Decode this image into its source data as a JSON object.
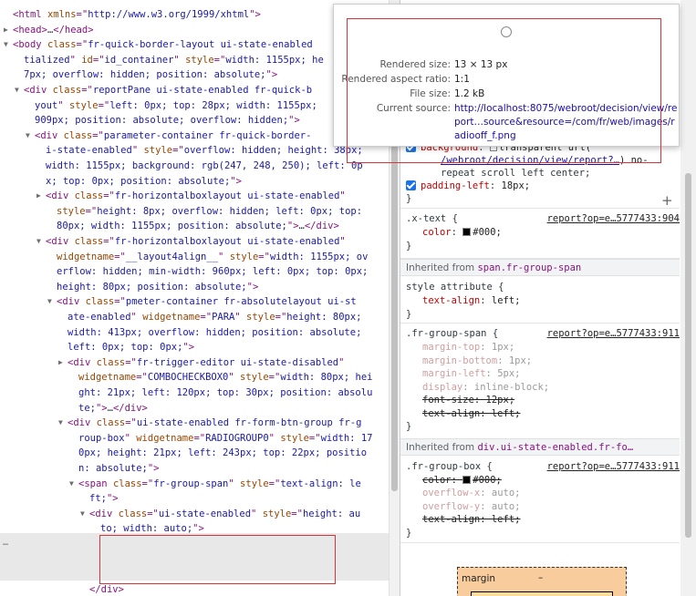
{
  "elements": {
    "lines": [
      {
        "indent": 1,
        "tri": "",
        "parts": [
          [
            "tag",
            "<html "
          ],
          [
            "attr",
            "xmlns"
          ],
          [
            "tag",
            "=\""
          ],
          [
            "val",
            "http://www.w3.org/1999/xhtml"
          ],
          [
            "tag",
            "\">"
          ]
        ]
      },
      {
        "indent": 1,
        "tri": "▶",
        "parts": [
          [
            "tag",
            "<head>"
          ],
          [
            "txt",
            "…"
          ],
          [
            "tag",
            "</head>"
          ]
        ]
      },
      {
        "indent": 1,
        "tri": "▼",
        "parts": [
          [
            "tag",
            "<body "
          ],
          [
            "attr",
            "class"
          ],
          [
            "tag",
            "=\""
          ],
          [
            "val",
            "fr-quick-border-layout ui-state-enabled"
          ]
        ]
      },
      {
        "indent": 2,
        "tri": "",
        "parts": [
          [
            "val",
            "tialized"
          ],
          [
            "tag",
            "\" "
          ],
          [
            "attr",
            "id"
          ],
          [
            "tag",
            "=\""
          ],
          [
            "val",
            "id_container"
          ],
          [
            "tag",
            "\" "
          ],
          [
            "attr",
            "style"
          ],
          [
            "tag",
            "=\""
          ],
          [
            "val",
            "width: 1155px; he"
          ]
        ]
      },
      {
        "indent": 2,
        "tri": "",
        "parts": [
          [
            "val",
            "7px; overflow: hidden; position: absolute;"
          ],
          [
            "tag",
            "\">"
          ]
        ]
      },
      {
        "indent": 2,
        "tri": "▼",
        "parts": [
          [
            "tag",
            "<div "
          ],
          [
            "attr",
            "class"
          ],
          [
            "tag",
            "=\""
          ],
          [
            "val",
            "reportPane ui-state-enabled fr-quick-b"
          ]
        ]
      },
      {
        "indent": 3,
        "tri": "",
        "parts": [
          [
            "val",
            "yout"
          ],
          [
            "tag",
            "\" "
          ],
          [
            "attr",
            "style"
          ],
          [
            "tag",
            "=\""
          ],
          [
            "val",
            "left: 0px; top: 28px; width: 1155px;"
          ]
        ]
      },
      {
        "indent": 3,
        "tri": "",
        "parts": [
          [
            "val",
            "909px; position: absolute; overflow: hidden;"
          ],
          [
            "tag",
            "\">"
          ]
        ]
      },
      {
        "indent": 3,
        "tri": "▼",
        "parts": [
          [
            "tag",
            "<div "
          ],
          [
            "attr",
            "class"
          ],
          [
            "tag",
            "=\""
          ],
          [
            "val",
            "parameter-container fr-quick-border-"
          ]
        ]
      },
      {
        "indent": 4,
        "tri": "",
        "parts": [
          [
            "val",
            "i-state-enabled"
          ],
          [
            "tag",
            "\" "
          ],
          [
            "attr",
            "style"
          ],
          [
            "tag",
            "=\""
          ],
          [
            "val",
            "overflow: hidden; height: 38px;"
          ]
        ]
      },
      {
        "indent": 4,
        "tri": "",
        "parts": [
          [
            "val",
            "width: 1155px; background: rgb(247, 248, 250); left: 0p"
          ]
        ]
      },
      {
        "indent": 4,
        "tri": "",
        "parts": [
          [
            "val",
            "x; top: 0px; position: absolute;"
          ],
          [
            "tag",
            "\">"
          ]
        ]
      },
      {
        "indent": 4,
        "tri": "▶",
        "parts": [
          [
            "tag",
            "<div "
          ],
          [
            "attr",
            "class"
          ],
          [
            "tag",
            "=\""
          ],
          [
            "val",
            "fr-horizontalboxlayout ui-state-enabled"
          ],
          [
            "tag",
            "\""
          ]
        ]
      },
      {
        "indent": 5,
        "tri": "",
        "parts": [
          [
            "attr",
            "style"
          ],
          [
            "tag",
            "=\""
          ],
          [
            "val",
            "height: 8px; overflow: hidden; left: 0px; top:"
          ]
        ]
      },
      {
        "indent": 5,
        "tri": "",
        "parts": [
          [
            "val",
            "80px; width: 1155px; position: absolute;"
          ],
          [
            "tag",
            "\">"
          ],
          [
            "txt",
            "…"
          ],
          [
            "tag",
            "</div>"
          ]
        ]
      },
      {
        "indent": 4,
        "tri": "▼",
        "parts": [
          [
            "tag",
            "<div "
          ],
          [
            "attr",
            "class"
          ],
          [
            "tag",
            "=\""
          ],
          [
            "val",
            "fr-horizontalboxlayout ui-state-enabled"
          ],
          [
            "tag",
            "\""
          ]
        ]
      },
      {
        "indent": 5,
        "tri": "",
        "parts": [
          [
            "attr",
            "widgetname"
          ],
          [
            "tag",
            "=\""
          ],
          [
            "val",
            "__layout4align__"
          ],
          [
            "tag",
            "\" "
          ],
          [
            "attr",
            "style"
          ],
          [
            "tag",
            "=\""
          ],
          [
            "val",
            "width: 1155px; ov"
          ]
        ]
      },
      {
        "indent": 5,
        "tri": "",
        "parts": [
          [
            "val",
            "erflow: hidden; min-width: 960px; left: 0px; top: 0px;"
          ]
        ]
      },
      {
        "indent": 5,
        "tri": "",
        "parts": [
          [
            "val",
            "height: 80px; position: absolute;"
          ],
          [
            "tag",
            "\">"
          ]
        ]
      },
      {
        "indent": 5,
        "tri": "▼",
        "parts": [
          [
            "tag",
            "<div "
          ],
          [
            "attr",
            "class"
          ],
          [
            "tag",
            "=\""
          ],
          [
            "val",
            "pmeter-container fr-absolutelayout ui-st"
          ]
        ]
      },
      {
        "indent": 6,
        "tri": "",
        "parts": [
          [
            "val",
            "ate-enabled"
          ],
          [
            "tag",
            "\" "
          ],
          [
            "attr",
            "widgetname"
          ],
          [
            "tag",
            "=\""
          ],
          [
            "val",
            "PARA"
          ],
          [
            "tag",
            "\" "
          ],
          [
            "attr",
            "style"
          ],
          [
            "tag",
            "=\""
          ],
          [
            "val",
            "height: 80px;"
          ]
        ]
      },
      {
        "indent": 6,
        "tri": "",
        "parts": [
          [
            "val",
            "width: 413px; overflow: hidden; position: absolute;"
          ]
        ]
      },
      {
        "indent": 6,
        "tri": "",
        "parts": [
          [
            "val",
            "left: 0px; top: 0px;"
          ],
          [
            "tag",
            "\">"
          ]
        ]
      },
      {
        "indent": 6,
        "tri": "▶",
        "parts": [
          [
            "tag",
            "<div "
          ],
          [
            "attr",
            "class"
          ],
          [
            "tag",
            "=\""
          ],
          [
            "val",
            "fr-trigger-editor ui-state-disabled"
          ],
          [
            "tag",
            "\""
          ]
        ]
      },
      {
        "indent": 7,
        "tri": "",
        "parts": [
          [
            "attr",
            "widgetname"
          ],
          [
            "tag",
            "=\""
          ],
          [
            "val",
            "COMBOCHECKBOX0"
          ],
          [
            "tag",
            "\" "
          ],
          [
            "attr",
            "style"
          ],
          [
            "tag",
            "=\""
          ],
          [
            "val",
            "width: 80px; hei"
          ]
        ]
      },
      {
        "indent": 7,
        "tri": "",
        "parts": [
          [
            "val",
            "ght: 21px; left: 120px; top: 30px; position: absolu"
          ]
        ]
      },
      {
        "indent": 7,
        "tri": "",
        "parts": [
          [
            "val",
            "te;"
          ],
          [
            "tag",
            "\">"
          ],
          [
            "txt",
            "…"
          ],
          [
            "tag",
            "</div>"
          ]
        ]
      },
      {
        "indent": 6,
        "tri": "▼",
        "parts": [
          [
            "tag",
            "<div "
          ],
          [
            "attr",
            "class"
          ],
          [
            "tag",
            "=\""
          ],
          [
            "val",
            "ui-state-enabled fr-form-btn-group fr-g"
          ]
        ]
      },
      {
        "indent": 7,
        "tri": "",
        "parts": [
          [
            "val",
            "roup-box"
          ],
          [
            "tag",
            "\" "
          ],
          [
            "attr",
            "widgetname"
          ],
          [
            "tag",
            "=\""
          ],
          [
            "val",
            "RADIOGROUP0"
          ],
          [
            "tag",
            "\" "
          ],
          [
            "attr",
            "style"
          ],
          [
            "tag",
            "=\""
          ],
          [
            "val",
            "width: 17"
          ]
        ]
      },
      {
        "indent": 7,
        "tri": "",
        "parts": [
          [
            "val",
            "0px; height: 21px; left: 243px; top: 22px; positio"
          ]
        ]
      },
      {
        "indent": 7,
        "tri": "",
        "parts": [
          [
            "val",
            "n: absolute;"
          ],
          [
            "tag",
            "\">"
          ]
        ]
      },
      {
        "indent": 7,
        "tri": "▼",
        "parts": [
          [
            "tag",
            "<span "
          ],
          [
            "attr",
            "class"
          ],
          [
            "tag",
            "=\""
          ],
          [
            "val",
            "fr-group-span"
          ],
          [
            "tag",
            "\" "
          ],
          [
            "attr",
            "style"
          ],
          [
            "tag",
            "=\""
          ],
          [
            "val",
            "text-align: le"
          ]
        ]
      },
      {
        "indent": 8,
        "tri": "",
        "parts": [
          [
            "val",
            "ft;"
          ],
          [
            "tag",
            "\">"
          ]
        ]
      },
      {
        "indent": 8,
        "tri": "▼",
        "parts": [
          [
            "tag",
            "<div "
          ],
          [
            "attr",
            "class"
          ],
          [
            "tag",
            "=\""
          ],
          [
            "val",
            "ui-state-enabled"
          ],
          [
            "tag",
            "\" "
          ],
          [
            "attr",
            "style"
          ],
          [
            "tag",
            "=\""
          ],
          [
            "val",
            "height: au"
          ]
        ]
      },
      {
        "indent": 9,
        "tri": "",
        "parts": [
          [
            "val",
            "to; width: auto;"
          ],
          [
            "tag",
            "\">"
          ]
        ]
      },
      {
        "indent": 9,
        "tri": "",
        "parts": [
          [
            "tag",
            "<span "
          ],
          [
            "attr",
            "class"
          ],
          [
            "tag",
            "=\""
          ],
          [
            "val",
            "x-text fr-widget-click fr-radio-"
          ]
        ]
      },
      {
        "indent": 9,
        "tri": "",
        "parts": [
          [
            "val",
            "radiooff"
          ],
          [
            "tag",
            "\" "
          ],
          [
            "attr",
            "style"
          ],
          [
            "tag",
            "=\""
          ],
          [
            "val",
            "padding-top: 1px; font-size:"
          ]
        ]
      },
      {
        "indent": 9,
        "tri": "",
        "parts": [
          [
            "val",
            "12px;"
          ],
          [
            "tag",
            "\">"
          ],
          [
            "txt",
            "A"
          ],
          [
            "tag",
            "</span>"
          ],
          [
            "eq",
            " == $0"
          ]
        ]
      },
      {
        "indent": 8,
        "tri": "",
        "parts": [
          [
            "tag",
            "</div>"
          ]
        ]
      }
    ],
    "dots": "…"
  },
  "popup": {
    "rendered_size_k": "Rendered size:",
    "rendered_size_v": "13 × 13 px",
    "aspect_k": "Rendered aspect ratio:",
    "aspect_v": "1:1",
    "file_size_k": "File size:",
    "file_size_v": "1.2 kB",
    "source_k": "Current source:",
    "source_v": "http://localhost:8075/webroot/decision/view/report…source&resource=/com/fr/web/images/radiooff_f.png"
  },
  "styles": {
    "rule1": {
      "bg_prop": "background",
      "bg_val_1": "transparent url(",
      "bg_link": "/webroot/decision/view/report?…",
      "bg_val_2": ") no-",
      "bg_val_3": "repeat scroll left center;",
      "pl_prop": "padding-left",
      "pl_val": "18px;",
      "close": "}"
    },
    "rule2": {
      "selector": ".x-text {",
      "source": "report?op=e…5777433:904",
      "color_prop": "color",
      "color_val": "#000;",
      "close": "}"
    },
    "inherited1": {
      "label": "Inherited from ",
      "target": "span.fr-group-span"
    },
    "rule3": {
      "selector": "style attribute {",
      "prop": "text-align",
      "val": "left;",
      "close": "}"
    },
    "rule4": {
      "selector": ".fr-group-span {",
      "source": "report?op=e…5777433:911",
      "props": [
        {
          "p": "margin-top",
          "v": "1px;",
          "kind": "dim"
        },
        {
          "p": "margin-bottom",
          "v": "1px;",
          "kind": "dim"
        },
        {
          "p": "margin-left",
          "v": "5px;",
          "kind": "dim"
        },
        {
          "p": "display",
          "v": "inline-block;",
          "kind": "dim"
        },
        {
          "p": "font-size",
          "v": "12px;",
          "kind": "strike"
        },
        {
          "p": "text-align",
          "v": "left;",
          "kind": "strike"
        }
      ],
      "close": "}"
    },
    "inherited2": {
      "label": "Inherited from ",
      "target": "div.ui-state-enabled.fr-fo…"
    },
    "rule5": {
      "selector": ".fr-group-box {",
      "source": "report?op=e…5777433:911",
      "color_prop": "color",
      "color_val": "#000;",
      "props": [
        {
          "p": "overflow-x",
          "v": "auto;",
          "kind": "dim"
        },
        {
          "p": "overflow-y",
          "v": "auto;",
          "kind": "dim"
        },
        {
          "p": "text-align",
          "v": "left;",
          "kind": "strike"
        }
      ],
      "close": "}"
    },
    "plus": "+",
    "boxmodel": {
      "label": "margin",
      "value": "–"
    }
  }
}
